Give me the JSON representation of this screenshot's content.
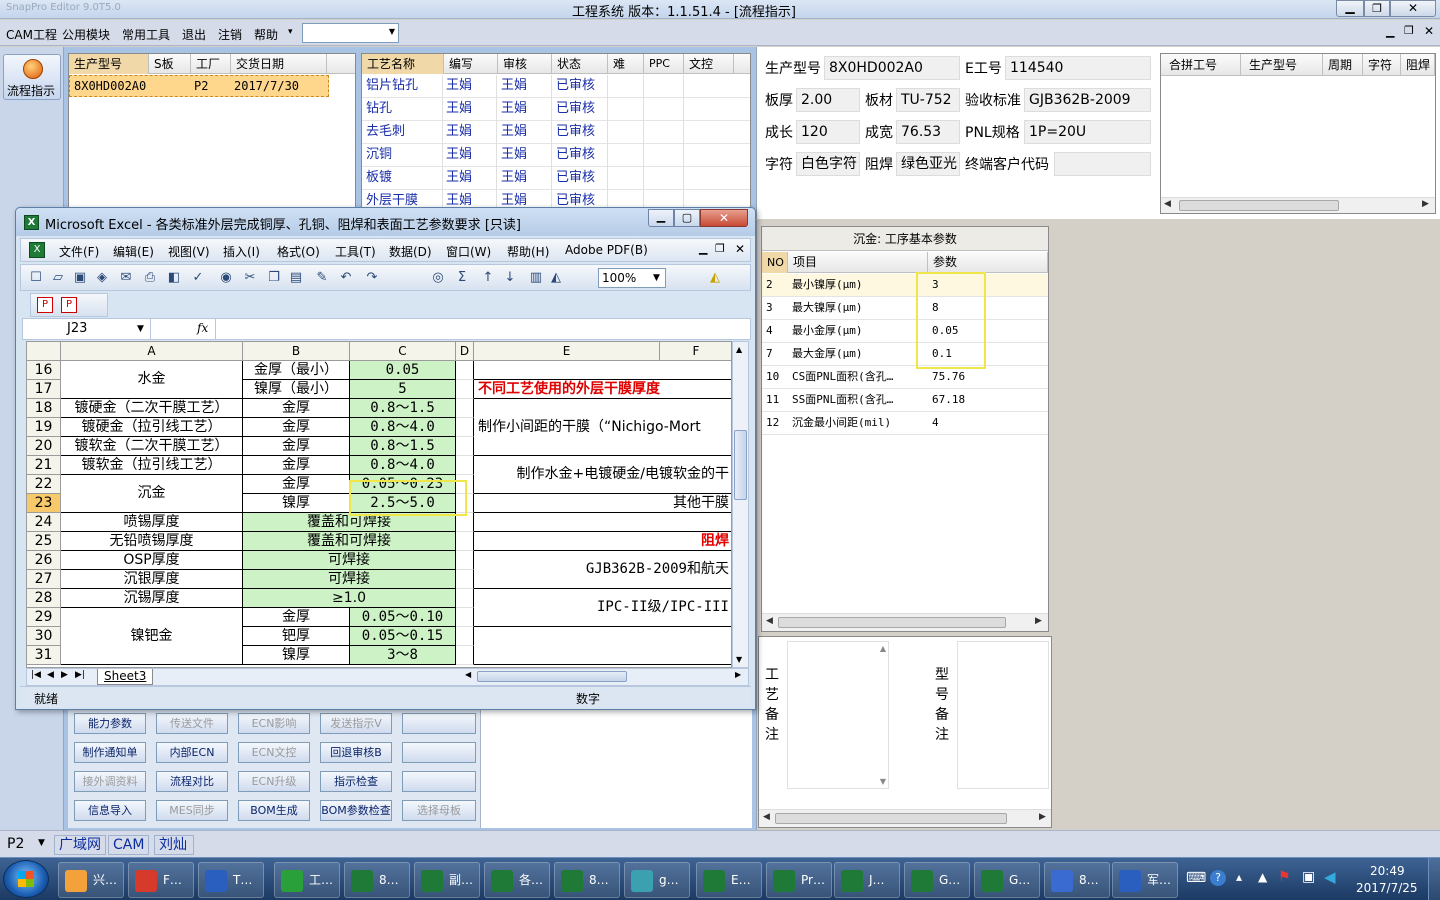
{
  "titlebar": {
    "left_text": "SnapPro Editor 9.0T5.0",
    "title": "工程系统   版本：1.1.51.4 - [流程指示]"
  },
  "menubar": [
    "CAM工程",
    "公用模块",
    "常用工具",
    "退出",
    "注销",
    "帮助"
  ],
  "side_button": "流程指示",
  "order_table": {
    "headers": [
      "生产型号",
      "S板",
      "工厂",
      "交货日期"
    ],
    "row": [
      "8X0HD002A0",
      "",
      "P2",
      "2017/7/30"
    ]
  },
  "process_table": {
    "headers": [
      "工艺名称",
      "编写",
      "审核",
      "状态",
      "难",
      "PPC",
      "文控"
    ],
    "rows": [
      [
        "铝片钻孔",
        "王娟",
        "王娟",
        "已审核"
      ],
      [
        "钻孔",
        "王娟",
        "王娟",
        "已审核"
      ],
      [
        "去毛刺",
        "王娟",
        "王娟",
        "已审核"
      ],
      [
        "沉铜",
        "王娟",
        "王娟",
        "已审核"
      ],
      [
        "板镀",
        "王娟",
        "王娟",
        "已审核"
      ],
      [
        "外层干膜",
        "王娟",
        "王娟",
        "已审核"
      ]
    ]
  },
  "info": {
    "labels": [
      "生产型号",
      "E工号",
      "板厚",
      "板材",
      "验收标准",
      "成长",
      "成宽",
      "PNL规格",
      "字符",
      "阻焊",
      "终端客户代码"
    ],
    "model": "8X0HD002A0",
    "e_no": "114540",
    "thickness": "2.00",
    "material": "TU-752",
    "standard": "GJB362B-2009",
    "length": "120",
    "width": "76.53",
    "pnl": "1P=20U",
    "char": "白色字符",
    "mask": "绿色亚光",
    "customer_code": ""
  },
  "merge_table": {
    "headers": [
      "合拼工号",
      "生产型号",
      "周期",
      "字符",
      "阻焊"
    ]
  },
  "param_panel": {
    "title": "沉金: 工序基本参数",
    "headers": [
      "NO",
      "项目",
      "参数"
    ],
    "rows": [
      [
        "2",
        "最小镍厚(μm)",
        "3"
      ],
      [
        "3",
        "最大镍厚(μm)",
        "8"
      ],
      [
        "4",
        "最小金厚(μm)",
        "0.05"
      ],
      [
        "7",
        "最大金厚(μm)",
        "0.1"
      ],
      [
        "10",
        "CS面PNL面积(含孔…",
        "75.76"
      ],
      [
        "11",
        "SS面PNL面积(含孔…",
        "67.18"
      ],
      [
        "12",
        "沉金最小间距(mil)",
        "4"
      ]
    ]
  },
  "notes": {
    "process_note": "工艺备注",
    "model_note": "型号备注"
  },
  "bottom_buttons": [
    [
      "能力参数",
      "传送文件",
      "ECN影响",
      "发送指示V",
      ""
    ],
    [
      "制作通知单",
      "内部ECN",
      "ECN文控",
      "回退审核B",
      ""
    ],
    [
      "接外调资料",
      "流程对比",
      "ECN升级",
      "指示检查",
      ""
    ],
    [
      "信息导入",
      "MES同步",
      "BOM生成",
      "BOM参数检查",
      "选择母板"
    ]
  ],
  "statusbar": {
    "dropdown": "P2",
    "items": [
      "广域网",
      "CAM",
      "刘灿"
    ]
  },
  "excel": {
    "title": "Microsoft Excel - 各类标准外层完成铜厚、孔铜、阻焊和表面工艺参数要求  [只读]",
    "menu": [
      "文件(F)",
      "编辑(E)",
      "视图(V)",
      "插入(I)",
      "格式(O)",
      "工具(T)",
      "数据(D)",
      "窗口(W)",
      "帮助(H)",
      "Adobe PDF(B)"
    ],
    "zoom": "100%",
    "namebox": "J23",
    "fx": "fx",
    "columns": [
      "A",
      "B",
      "C",
      "D",
      "E",
      "F"
    ],
    "rows": [
      "16",
      "17",
      "18",
      "19",
      "20",
      "21",
      "22",
      "23",
      "24",
      "25",
      "26",
      "27",
      "28",
      "29",
      "30",
      "31"
    ],
    "cells": {
      "a_shuijin": "水金",
      "b16": "金厚（最小）",
      "c16": "0.05",
      "b17": "镍厚（最小）",
      "c17": "5",
      "a18": "镀硬金（二次干膜工艺）",
      "b18": "金厚",
      "c18": "0.8～1.5",
      "a19": "镀硬金（拉引线工艺）",
      "b19": "金厚",
      "c19": "0.8～4.0",
      "a20": "镀软金（二次干膜工艺）",
      "b20": "金厚",
      "c20": "0.8～1.5",
      "a21": "镀软金（拉引线工艺）",
      "b21": "金厚",
      "c21": "0.8～4.0",
      "a_chenjin": "沉金",
      "b22": "金厚",
      "c22": "0.05～0.23",
      "b23": "镍厚",
      "c23": "2.5～5.0",
      "a24": "喷锡厚度",
      "bc24": "覆盖和可焊接",
      "a25": "无铅喷锡厚度",
      "bc25": "覆盖和可焊接",
      "a26": "OSP厚度",
      "bc26": "可焊接",
      "a27": "沉银厚度",
      "bc27": "可焊接",
      "a28": "沉锡厚度",
      "bc28": "≥1.0",
      "a_niebajin": "镍钯金",
      "b29": "金厚",
      "c29": "0.05～0.10",
      "b30": "钯厚",
      "c30": "0.05～0.15",
      "b31": "镍厚",
      "c31": "3～8",
      "e17": "不同工艺使用的外层干膜厚度",
      "e19": "制作小间距的干膜（“Nichigo-Mort",
      "e21": "制作水金+电镀硬金/电镀软金的干",
      "e23": "其他干膜",
      "e25": "阻焊",
      "e26": "GJB362B-2009和航天",
      "e28": "IPC-II级/IPC-III"
    },
    "sheet_tab": "Sheet3",
    "status_left": "就绪",
    "status_mid": "数字"
  },
  "taskbar": {
    "items": [
      "兴…",
      "F…",
      "T…",
      "工…",
      "8…",
      "副…",
      "各…",
      "8…",
      "g…",
      "E…",
      "Pr…",
      "J…",
      "G…",
      "G…",
      "8…",
      "军…"
    ],
    "time": "20:49",
    "date": "2017/7/25"
  }
}
